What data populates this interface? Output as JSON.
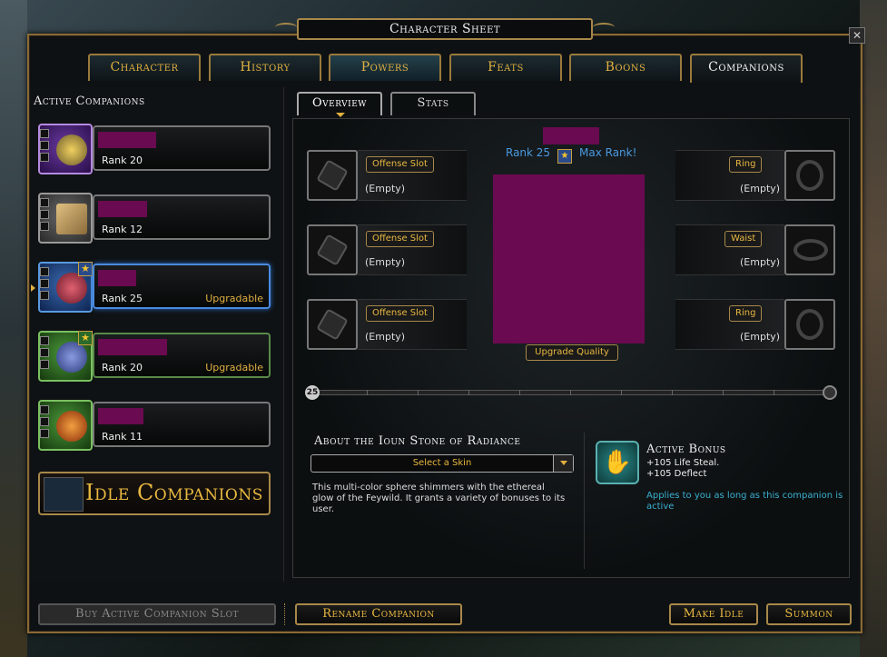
{
  "window": {
    "title": "Character Sheet",
    "close_label": "✕"
  },
  "tabs": [
    {
      "label": "Character"
    },
    {
      "label": "History"
    },
    {
      "label": "Powers"
    },
    {
      "label": "Feats"
    },
    {
      "label": "Boons"
    },
    {
      "label": "Companions"
    }
  ],
  "left": {
    "header": "Active Companions",
    "companions": [
      {
        "rank": "Rank 20",
        "status": ""
      },
      {
        "rank": "Rank 12",
        "status": ""
      },
      {
        "rank": "Rank 25",
        "status": "Upgradable"
      },
      {
        "rank": "Rank 20",
        "status": "Upgradable"
      },
      {
        "rank": "Rank 11",
        "status": ""
      }
    ],
    "idle_button": "Idle Companions"
  },
  "subtabs": [
    {
      "label": "Overview"
    },
    {
      "label": "Stats"
    }
  ],
  "overview": {
    "rank_label": "Rank 25",
    "max_rank_label": "Max Rank!",
    "upgrade_quality": "Upgrade Quality",
    "left_slots": [
      {
        "button": "Offense Slot",
        "value": "(Empty)"
      },
      {
        "button": "Offense Slot",
        "value": "(Empty)"
      },
      {
        "button": "Offense Slot",
        "value": "(Empty)"
      }
    ],
    "right_slots": [
      {
        "button": "Ring",
        "value": "(Empty)"
      },
      {
        "button": "Waist",
        "value": "(Empty)"
      },
      {
        "button": "Ring",
        "value": "(Empty)"
      }
    ],
    "xp_start": "25",
    "xp_progress": 0
  },
  "about": {
    "title": "About the Ioun Stone of Radiance",
    "skin_select": "Select a Skin",
    "description": "This multi-color sphere shimmers with the ethereal glow of the Feywild. It grants a variety of bonuses to its user."
  },
  "bonus": {
    "title": "Active Bonus",
    "lines": [
      "+105 Life Steal.",
      "+105 Deflect"
    ],
    "applies": "Applies to you as long as this companion is active"
  },
  "footer": {
    "buy_slot": "Buy Active Companion Slot",
    "rename": "Rename Companion",
    "make_idle": "Make Idle",
    "summon": "Summon"
  },
  "colors": {
    "accent_gold": "#e8b840",
    "frame_gold": "#a8884a",
    "rank_blue": "#4a9ae0",
    "bonus_teal": "#3ab0d0",
    "redaction": "#6a0a50"
  }
}
